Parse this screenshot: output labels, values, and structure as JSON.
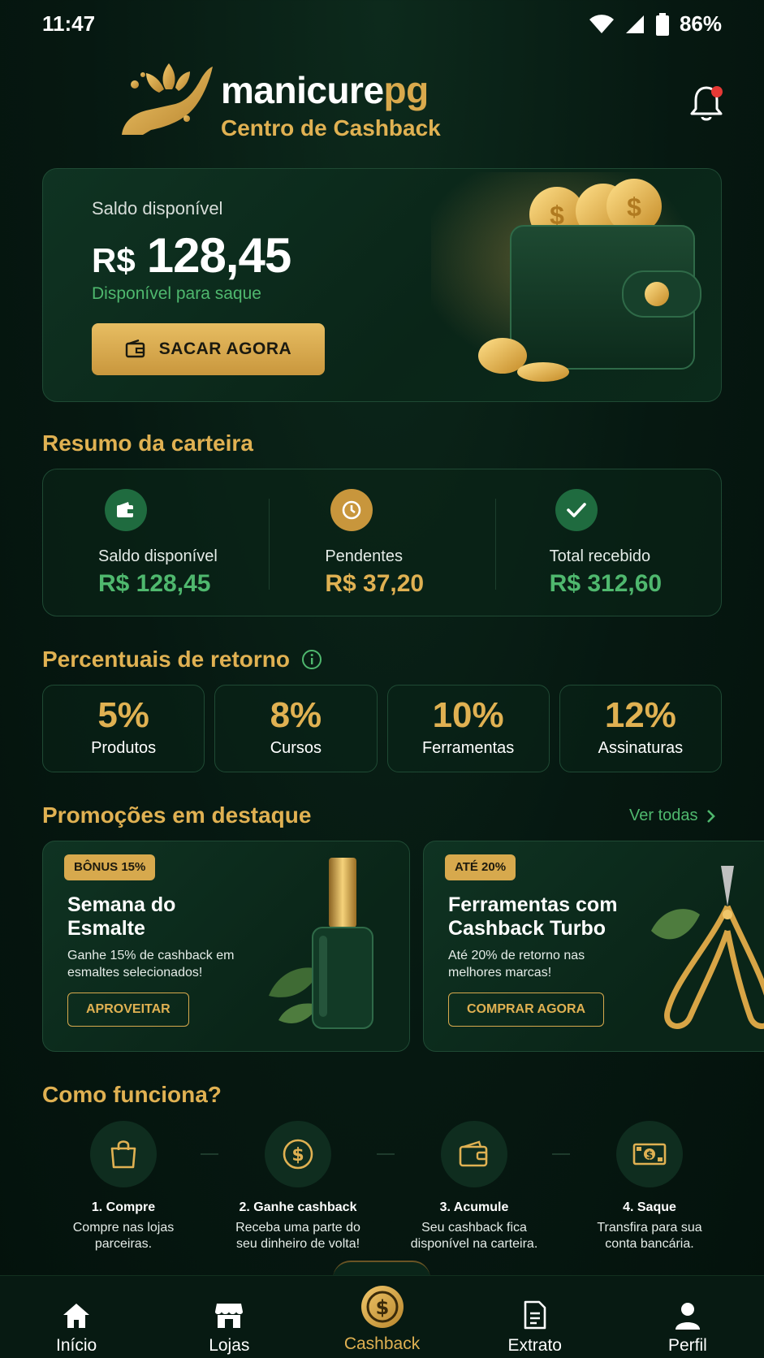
{
  "status_bar": {
    "time": "11:47",
    "battery": "86%"
  },
  "header": {
    "brand_main": "manicure",
    "brand_accent": "pg",
    "subtitle": "Centro de Cashback"
  },
  "balance": {
    "label": "Saldo disponível",
    "currency": "R$",
    "amount": "128,45",
    "sub": "Disponível para saque",
    "button_label": "SACAR AGORA"
  },
  "summary": {
    "title": "Resumo da carteira",
    "items": [
      {
        "label": "Saldo disponível",
        "value": "R$ 128,45",
        "icon": "wallet-icon",
        "icon_bg": "#1f6b3f"
      },
      {
        "label": "Pendentes",
        "value": "R$ 37,20",
        "icon": "clock-icon",
        "icon_bg": "#c8963c"
      },
      {
        "label": "Total recebido",
        "value": "R$ 312,60",
        "icon": "check-icon",
        "icon_bg": "#1f6b3f"
      }
    ]
  },
  "rates": {
    "title": "Percentuais de retorno",
    "items": [
      {
        "pct": "5%",
        "label": "Produtos"
      },
      {
        "pct": "8%",
        "label": "Cursos"
      },
      {
        "pct": "10%",
        "label": "Ferramentas"
      },
      {
        "pct": "12%",
        "label": "Assinaturas"
      }
    ]
  },
  "promos": {
    "title": "Promoções em destaque",
    "see_all": "Ver todas",
    "items": [
      {
        "badge": "BÔNUS 15%",
        "title": "Semana do Esmalte",
        "desc": "Ganhe 15% de cashback em esmaltes selecionados!",
        "button": "APROVEITAR"
      },
      {
        "badge": "ATÉ 20%",
        "title": "Ferramentas com Cashback Turbo",
        "desc": "Até 20% de retorno nas melhores marcas!",
        "button": "COMPRAR AGORA"
      }
    ]
  },
  "how": {
    "title": "Como funciona?",
    "steps": [
      {
        "title": "1. Compre",
        "desc": "Compre nas lojas parceiras.",
        "icon": "shopping-bag-icon"
      },
      {
        "title": "2. Ganhe cashback",
        "desc": "Receba uma parte do seu dinheiro de volta!",
        "icon": "dollar-coin-icon"
      },
      {
        "title": "3. Acumule",
        "desc": "Seu cashback fica disponível na carteira.",
        "icon": "wallet-icon"
      },
      {
        "title": "4. Saque",
        "desc": "Transfira para sua conta bancária.",
        "icon": "banknote-icon"
      }
    ]
  },
  "nav": {
    "items": [
      {
        "label": "Início",
        "icon": "home-icon"
      },
      {
        "label": "Lojas",
        "icon": "store-icon"
      },
      {
        "label": "Cashback",
        "icon": "cashback-coin-icon",
        "active": true
      },
      {
        "label": "Extrato",
        "icon": "document-icon"
      },
      {
        "label": "Perfil",
        "icon": "user-icon"
      }
    ]
  },
  "colors": {
    "gold": "#e0b152",
    "green_accent": "#4fb86e",
    "background": "#061811",
    "notification_dot": "#e53935"
  }
}
